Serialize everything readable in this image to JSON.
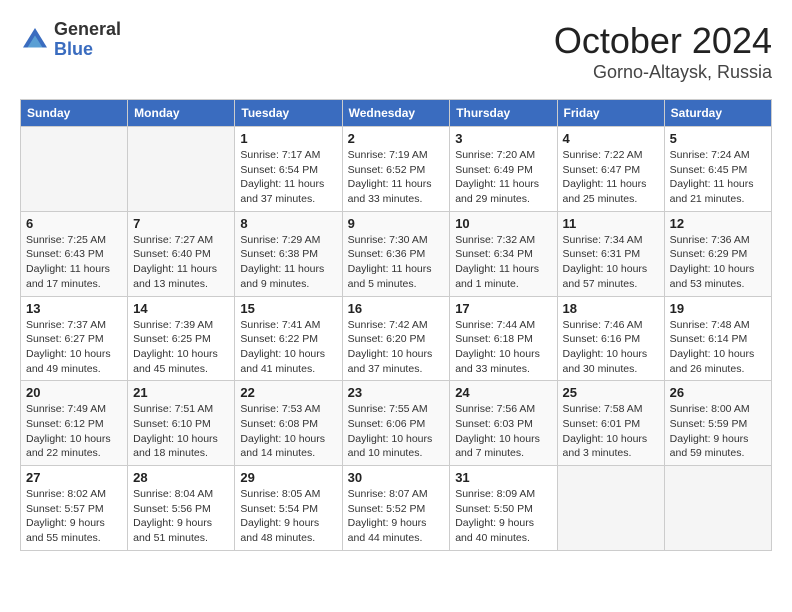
{
  "logo": {
    "general": "General",
    "blue": "Blue"
  },
  "title": "October 2024",
  "location": "Gorno-Altaysk, Russia",
  "weekdays": [
    "Sunday",
    "Monday",
    "Tuesday",
    "Wednesday",
    "Thursday",
    "Friday",
    "Saturday"
  ],
  "weeks": [
    [
      {
        "day": "",
        "info": ""
      },
      {
        "day": "",
        "info": ""
      },
      {
        "day": "1",
        "info": "Sunrise: 7:17 AM\nSunset: 6:54 PM\nDaylight: 11 hours and 37 minutes."
      },
      {
        "day": "2",
        "info": "Sunrise: 7:19 AM\nSunset: 6:52 PM\nDaylight: 11 hours and 33 minutes."
      },
      {
        "day": "3",
        "info": "Sunrise: 7:20 AM\nSunset: 6:49 PM\nDaylight: 11 hours and 29 minutes."
      },
      {
        "day": "4",
        "info": "Sunrise: 7:22 AM\nSunset: 6:47 PM\nDaylight: 11 hours and 25 minutes."
      },
      {
        "day": "5",
        "info": "Sunrise: 7:24 AM\nSunset: 6:45 PM\nDaylight: 11 hours and 21 minutes."
      }
    ],
    [
      {
        "day": "6",
        "info": "Sunrise: 7:25 AM\nSunset: 6:43 PM\nDaylight: 11 hours and 17 minutes."
      },
      {
        "day": "7",
        "info": "Sunrise: 7:27 AM\nSunset: 6:40 PM\nDaylight: 11 hours and 13 minutes."
      },
      {
        "day": "8",
        "info": "Sunrise: 7:29 AM\nSunset: 6:38 PM\nDaylight: 11 hours and 9 minutes."
      },
      {
        "day": "9",
        "info": "Sunrise: 7:30 AM\nSunset: 6:36 PM\nDaylight: 11 hours and 5 minutes."
      },
      {
        "day": "10",
        "info": "Sunrise: 7:32 AM\nSunset: 6:34 PM\nDaylight: 11 hours and 1 minute."
      },
      {
        "day": "11",
        "info": "Sunrise: 7:34 AM\nSunset: 6:31 PM\nDaylight: 10 hours and 57 minutes."
      },
      {
        "day": "12",
        "info": "Sunrise: 7:36 AM\nSunset: 6:29 PM\nDaylight: 10 hours and 53 minutes."
      }
    ],
    [
      {
        "day": "13",
        "info": "Sunrise: 7:37 AM\nSunset: 6:27 PM\nDaylight: 10 hours and 49 minutes."
      },
      {
        "day": "14",
        "info": "Sunrise: 7:39 AM\nSunset: 6:25 PM\nDaylight: 10 hours and 45 minutes."
      },
      {
        "day": "15",
        "info": "Sunrise: 7:41 AM\nSunset: 6:22 PM\nDaylight: 10 hours and 41 minutes."
      },
      {
        "day": "16",
        "info": "Sunrise: 7:42 AM\nSunset: 6:20 PM\nDaylight: 10 hours and 37 minutes."
      },
      {
        "day": "17",
        "info": "Sunrise: 7:44 AM\nSunset: 6:18 PM\nDaylight: 10 hours and 33 minutes."
      },
      {
        "day": "18",
        "info": "Sunrise: 7:46 AM\nSunset: 6:16 PM\nDaylight: 10 hours and 30 minutes."
      },
      {
        "day": "19",
        "info": "Sunrise: 7:48 AM\nSunset: 6:14 PM\nDaylight: 10 hours and 26 minutes."
      }
    ],
    [
      {
        "day": "20",
        "info": "Sunrise: 7:49 AM\nSunset: 6:12 PM\nDaylight: 10 hours and 22 minutes."
      },
      {
        "day": "21",
        "info": "Sunrise: 7:51 AM\nSunset: 6:10 PM\nDaylight: 10 hours and 18 minutes."
      },
      {
        "day": "22",
        "info": "Sunrise: 7:53 AM\nSunset: 6:08 PM\nDaylight: 10 hours and 14 minutes."
      },
      {
        "day": "23",
        "info": "Sunrise: 7:55 AM\nSunset: 6:06 PM\nDaylight: 10 hours and 10 minutes."
      },
      {
        "day": "24",
        "info": "Sunrise: 7:56 AM\nSunset: 6:03 PM\nDaylight: 10 hours and 7 minutes."
      },
      {
        "day": "25",
        "info": "Sunrise: 7:58 AM\nSunset: 6:01 PM\nDaylight: 10 hours and 3 minutes."
      },
      {
        "day": "26",
        "info": "Sunrise: 8:00 AM\nSunset: 5:59 PM\nDaylight: 9 hours and 59 minutes."
      }
    ],
    [
      {
        "day": "27",
        "info": "Sunrise: 8:02 AM\nSunset: 5:57 PM\nDaylight: 9 hours and 55 minutes."
      },
      {
        "day": "28",
        "info": "Sunrise: 8:04 AM\nSunset: 5:56 PM\nDaylight: 9 hours and 51 minutes."
      },
      {
        "day": "29",
        "info": "Sunrise: 8:05 AM\nSunset: 5:54 PM\nDaylight: 9 hours and 48 minutes."
      },
      {
        "day": "30",
        "info": "Sunrise: 8:07 AM\nSunset: 5:52 PM\nDaylight: 9 hours and 44 minutes."
      },
      {
        "day": "31",
        "info": "Sunrise: 8:09 AM\nSunset: 5:50 PM\nDaylight: 9 hours and 40 minutes."
      },
      {
        "day": "",
        "info": ""
      },
      {
        "day": "",
        "info": ""
      }
    ]
  ]
}
